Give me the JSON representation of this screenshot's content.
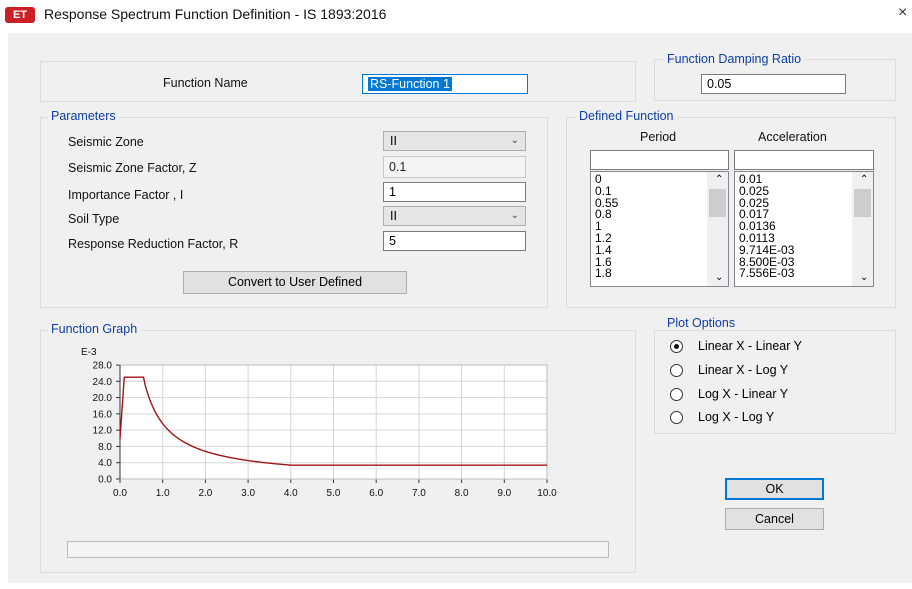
{
  "window": {
    "app_icon_text": "ET",
    "title": "Response Spectrum Function Definition - IS 1893:2016",
    "close_glyph": "×"
  },
  "function_name": {
    "label": "Function Name",
    "value": "RS-Function 1"
  },
  "damping": {
    "title": "Function Damping Ratio",
    "value": "0.05"
  },
  "parameters": {
    "title": "Parameters",
    "seismic_zone": {
      "label": "Seismic Zone",
      "value": "II"
    },
    "zone_factor": {
      "label": "Seismic Zone Factor, Z",
      "value": "0.1"
    },
    "importance": {
      "label": "Importance Factor , I",
      "value": "1"
    },
    "soil_type": {
      "label": "Soil Type",
      "value": "II"
    },
    "reduction": {
      "label": "Response Reduction Factor, R",
      "value": "5"
    },
    "convert_button": "Convert to User Defined"
  },
  "defined_function": {
    "title": "Defined Function",
    "period_header": "Period",
    "accel_header": "Acceleration",
    "periods": [
      "0",
      "0.1",
      "0.55",
      "0.8",
      "1",
      "1.2",
      "1.4",
      "1.6",
      "1.8"
    ],
    "accelerations": [
      "0.01",
      "0.025",
      "0.025",
      "0.017",
      "0.0136",
      "0.0113",
      "9.714E-03",
      "8.500E-03",
      "7.556E-03"
    ]
  },
  "function_graph": {
    "title": "Function Graph",
    "y_multiplier": "E-3",
    "x_ticks": [
      "0.0",
      "1.0",
      "2.0",
      "3.0",
      "4.0",
      "5.0",
      "6.0",
      "7.0",
      "8.0",
      "9.0",
      "10.0"
    ],
    "y_ticks": [
      "0.0",
      "4.0",
      "8.0",
      "12.0",
      "16.0",
      "20.0",
      "24.0",
      "28.0"
    ]
  },
  "chart_data": {
    "type": "line",
    "title": "",
    "xlabel": "",
    "ylabel": "",
    "xlim": [
      0,
      10
    ],
    "ylim": [
      0,
      28
    ],
    "grid": true,
    "series_color": "#a01418",
    "x": [
      0,
      0.1,
      0.55,
      0.8,
      1,
      1.2,
      1.4,
      1.6,
      1.8,
      2,
      2.5,
      3,
      3.5,
      4,
      5,
      6,
      7,
      8,
      9,
      10
    ],
    "y": [
      10,
      25,
      25,
      17,
      13.6,
      11.3,
      9.714,
      8.5,
      7.556,
      6.8,
      5.44,
      4.53,
      3.89,
      3.4,
      3.4,
      3.4,
      3.4,
      3.4,
      3.4,
      3.4
    ]
  },
  "plot_options": {
    "title": "Plot Options",
    "options": [
      "Linear X - Linear Y",
      "Linear X - Log Y",
      "Log X - Linear Y",
      "Log X - Log Y"
    ],
    "selected_index": 0
  },
  "buttons": {
    "ok": "OK",
    "cancel": "Cancel"
  },
  "status_bar_text": ""
}
